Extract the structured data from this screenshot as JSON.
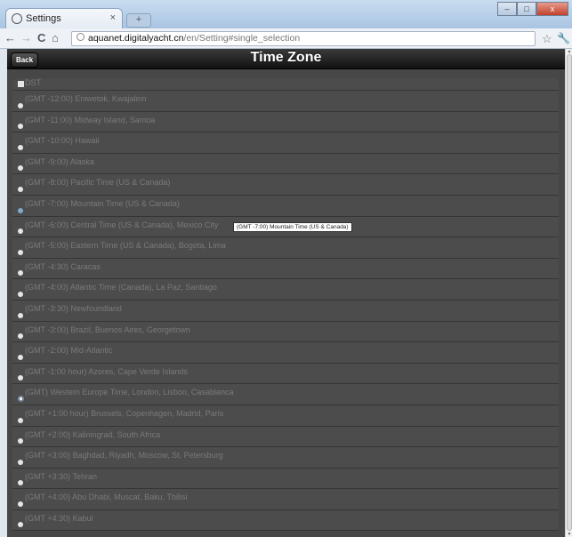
{
  "browser": {
    "tab_title": "Settings",
    "tab_close": "×",
    "new_tab": "+",
    "url_host": "aquanet.digitalyacht.cn",
    "url_path": "/en/Setting#single_selection",
    "window_controls": {
      "minimize": "–",
      "maximize": "□",
      "close": "x"
    }
  },
  "page": {
    "back_label": "Back",
    "title": "Time Zone"
  },
  "dst": {
    "label": "DST"
  },
  "timezones": [
    "(GMT -12:00) Eniwetok, Kwajalein",
    "(GMT -11:00) Midway Island, Samoa",
    "(GMT -10:00) Hawaii",
    "(GMT -9:00) Alaska",
    "(GMT -8:00) Pacific Time (US & Canada)",
    "(GMT -7:00) Mountain Time (US & Canada)",
    "(GMT -6:00) Central Time (US & Canada), Mexico City",
    "(GMT -5:00) Eastern Time (US & Canada), Bogota, Lima",
    "(GMT -4:30) Caracas",
    "(GMT -4:00) Atlantic Time (Canada), La Paz, Santiago",
    "(GMT -3:30) Newfoundland",
    "(GMT -3:00) Brazil, Buenos Aires, Georgetown",
    "(GMT -2:00) Mid-Atlantic",
    "(GMT -1:00 hour) Azores, Cape Verde Islands",
    "(GMT) Western Europe Time, London, Lisbon, Casablanca",
    "(GMT +1:00 hour) Brussels, Copenhagen, Madrid, Paris",
    "(GMT +2:00) Kaliningrad, South Africa",
    "(GMT +3:00) Baghdad, Riyadh, Moscow, St. Petersburg",
    "(GMT +3:30) Tehran",
    "(GMT +4:00) Abu Dhabi, Muscat, Baku, Tbilisi",
    "(GMT +4:30) Kabul"
  ],
  "selected_index": 14,
  "hover_index": 5,
  "tooltip": "(GMT -7:00) Mountain Time (US & Canada)"
}
